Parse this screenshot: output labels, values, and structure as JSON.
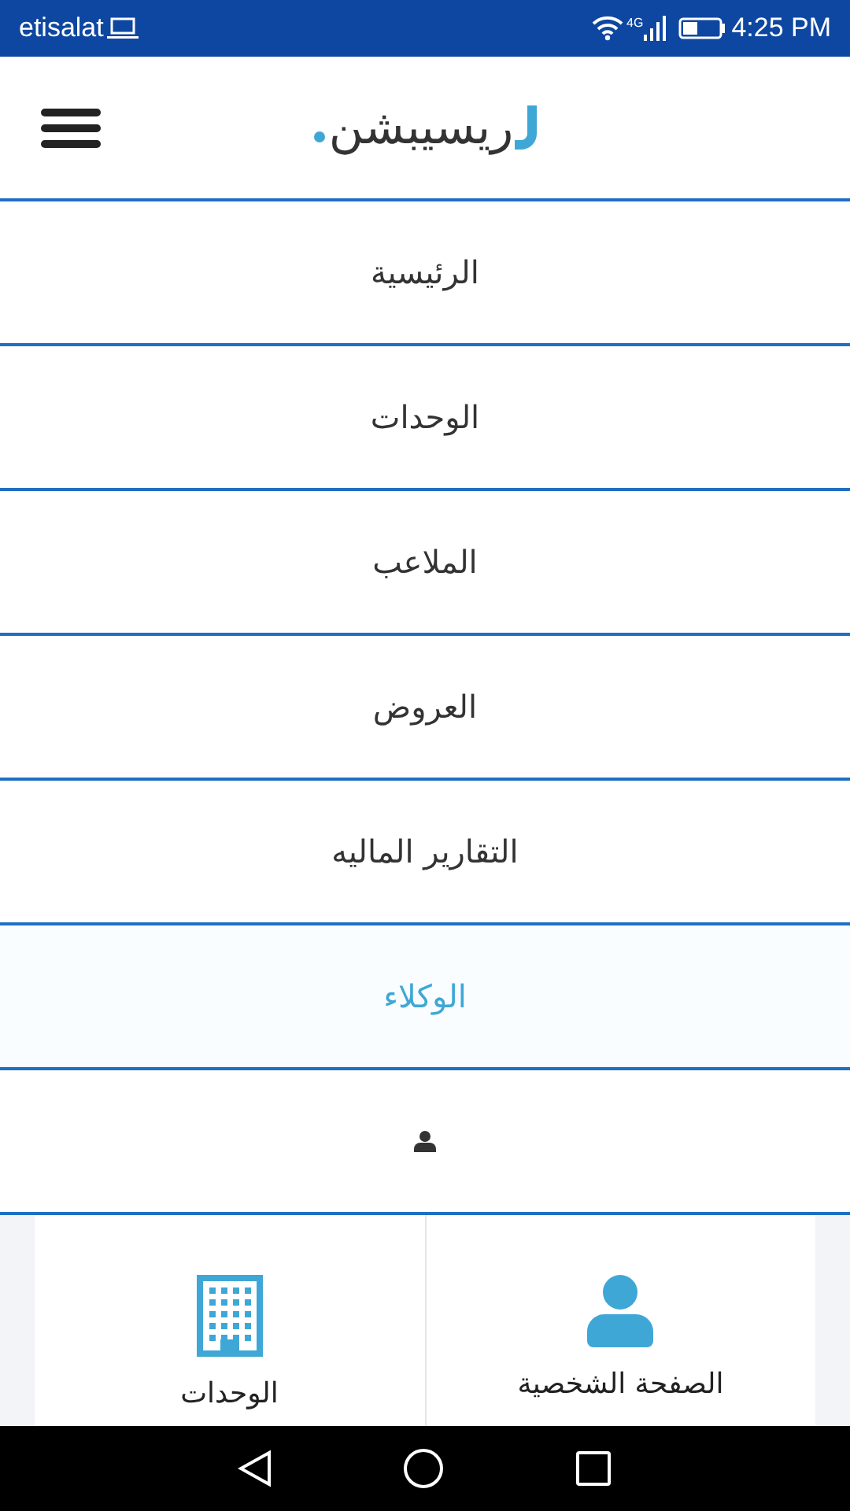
{
  "status_bar": {
    "carrier": "etisalat",
    "network": "4G",
    "time": "4:25 PM"
  },
  "header": {
    "logo": "ريسيبشن"
  },
  "menu": [
    {
      "kind": "text",
      "label": "الرئيسية",
      "selected": false
    },
    {
      "kind": "text",
      "label": "الوحدات",
      "selected": false
    },
    {
      "kind": "text",
      "label": "الملاعب",
      "selected": false
    },
    {
      "kind": "text",
      "label": "العروض",
      "selected": false
    },
    {
      "kind": "text",
      "label": "التقارير الماليه",
      "selected": false
    },
    {
      "kind": "text",
      "label": "الوكلاء",
      "selected": true
    },
    {
      "kind": "user-icon",
      "selected": false
    }
  ],
  "cards": [
    {
      "kind": "profile",
      "label": "الصفحة الشخصية"
    },
    {
      "kind": "units",
      "label": "الوحدات"
    }
  ]
}
